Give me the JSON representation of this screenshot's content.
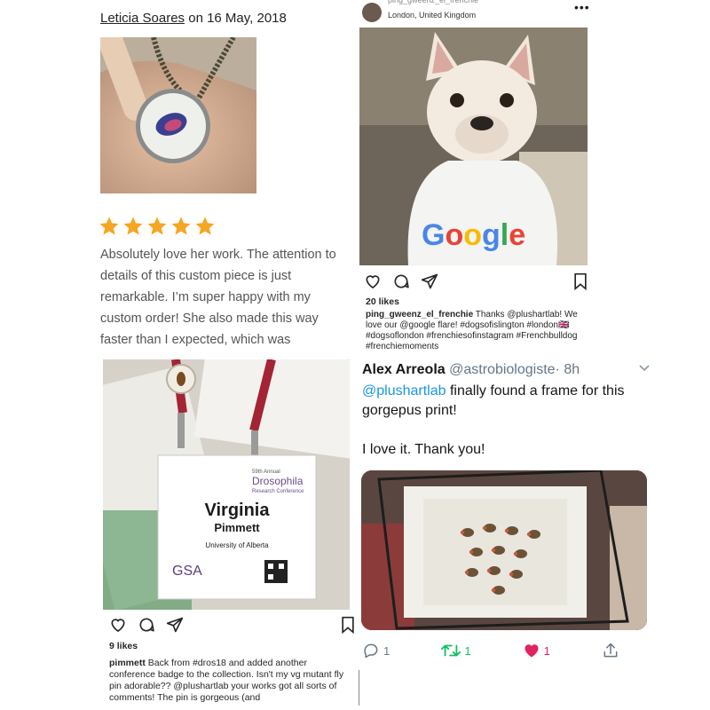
{
  "review": {
    "author": "Leticia Soares",
    "date_text": " on 16 May, 2018",
    "rating": 5,
    "star_color": "#f5a623",
    "text": "Absolutely love her work. The attention to details of this custom piece is just remarkable. I’m super happy with my custom order! She also made this way faster than I expected, which was"
  },
  "insta_dog": {
    "username_cut": "ping_gweenz_el_frenchie",
    "location": "London, United Kingdom",
    "more": "•••",
    "shirt_text": "Good",
    "likes": "20 likes",
    "caption_user": "ping_gweenz_el_frenchie",
    "caption_text": " Thanks @plushartlab! We love our @google flare! #dogsofislington #london🇬🇧 #dogsoflondon #frenchiesofinstagram #Frenchbulldog #frenchiemoments"
  },
  "insta_badge": {
    "badge": {
      "event_small": "59th Annual",
      "event_big": "Drosophila",
      "event_sub": "Research Conference",
      "first_name": "Virginia",
      "last_name": "Pimmett",
      "institution": "University of Alberta",
      "org": "GSA"
    },
    "likes": "9 likes",
    "caption_user": "pimmett",
    "caption_text": " Back from #dros18 and added another conference badge to the collection. Isn't my vg mutant fly pin adorable?? @plushartlab your works got all sorts of comments! The pin is gorgeous (and"
  },
  "tweet": {
    "name": "Alex Arreola",
    "handle": "@astrobiologiste",
    "time": "· 8h",
    "mention": "@plushartlab",
    "text_after_mention": " finally found a frame for this gorgepus print!",
    "text_line2": "I love it. Thank you!",
    "reply_count": "1",
    "retweet_count": "1",
    "like_count": "1",
    "colors": {
      "mention": "#1b95e0",
      "retweet": "#17bf63",
      "like": "#e0245e"
    }
  }
}
